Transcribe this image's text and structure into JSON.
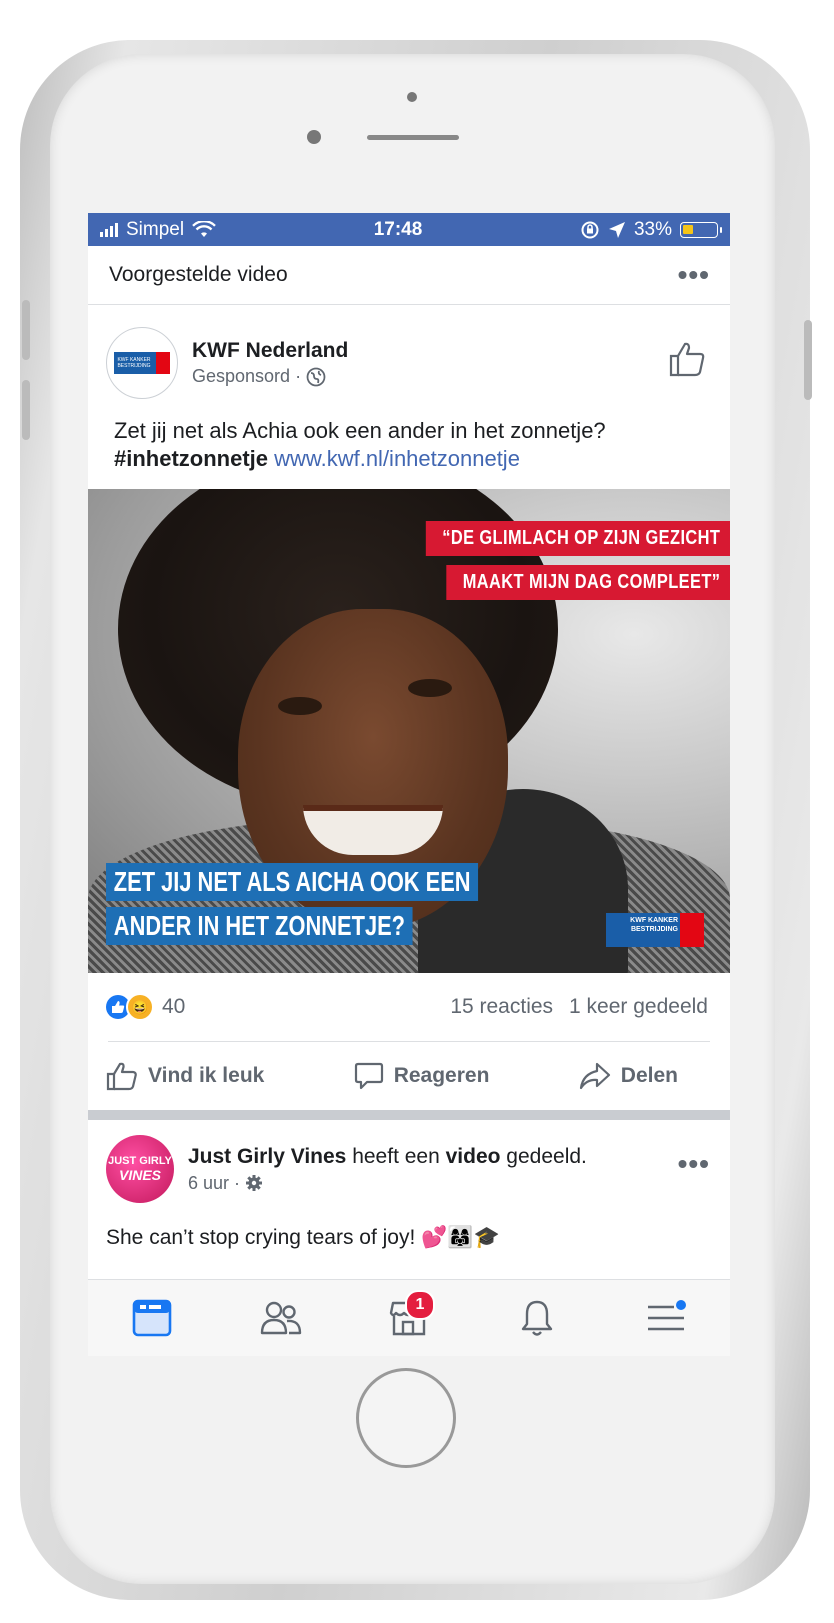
{
  "statusbar": {
    "carrier": "Simpel",
    "time": "17:48",
    "battery": "33%",
    "battery_level": 0.33
  },
  "section": {
    "title": "Voorgestelde video"
  },
  "post": {
    "page_name": "KWF Nederland",
    "sponsored": "Gesponsord",
    "meta_sep": "·",
    "text": "Zet jij net als Achia ook een ander in het zonnetje?",
    "hashtag": "#inhetzonnetje",
    "link": "www.kwf.nl/inhetzonnetje",
    "image": {
      "quote_line1": "“DE GLIMLACH OP ZIJN GEZICHT",
      "quote_line2": "MAAKT MIJN DAG COMPLEET”",
      "cta_line1": "ZET JIJ NET ALS AICHA OOK EEN",
      "cta_line2": "ANDER IN HET ZONNETJE?",
      "logo_text": "KWF KANKER BESTRIJDING"
    },
    "reaction_count": "40",
    "comments": "15 reacties",
    "shares": "1 keer gedeeld",
    "actions": {
      "like": "Vind ik leuk",
      "comment": "Reageren",
      "share": "Delen"
    }
  },
  "post2": {
    "page_name": "Just Girly Vines",
    "mid1": " heeft een ",
    "video_word": "video",
    "mid2": " gedeeld.",
    "time": "6 uur",
    "meta_sep": "·",
    "text": "She can’t stop crying tears of joy! 💕👩‍👩‍👧🎓",
    "avatar_top": "JUST GIRLY",
    "avatar_bottom": "VINES"
  },
  "tabbar": {
    "marketplace_badge": "1"
  },
  "colors": {
    "facebook_blue": "#4267b2",
    "kwf_red": "#d71932",
    "kwf_blue": "#1e6fb5"
  }
}
